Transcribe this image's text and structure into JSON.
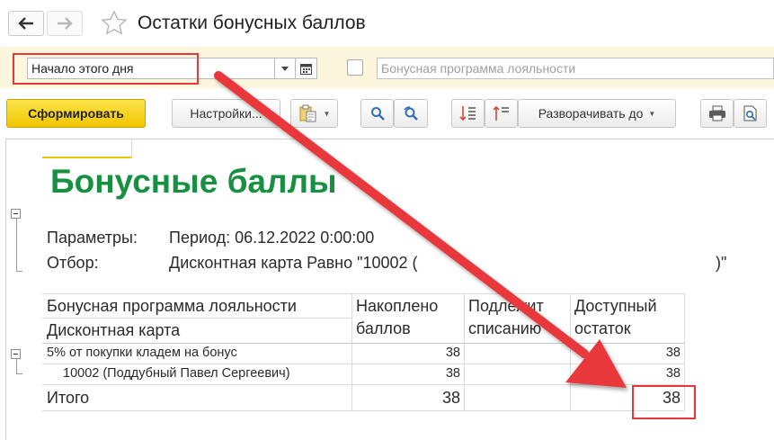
{
  "window": {
    "title": "Остатки бонусных баллов"
  },
  "filters": {
    "period_value": "Начало этого дня",
    "program_placeholder": "Бонусная программа лояльности"
  },
  "toolbar": {
    "generate_label": "Сформировать",
    "settings_label": "Настройки...",
    "expand_label": "Разворачивать до"
  },
  "report": {
    "heading": "Бонусные баллы",
    "params_label": "Параметры:",
    "params_value": "Период: 06.12.2022 0:00:00",
    "filter_label": "Отбор:",
    "filter_value_start": "Дисконтная карта Равно \"10002 (",
    "filter_value_end": ")\""
  },
  "table": {
    "group_header_1": "Бонусная программа лояльности",
    "group_header_2": "Дисконтная карта",
    "columns": [
      {
        "line1": "Накоплено",
        "line2": "баллов"
      },
      {
        "line1": "Подлежит",
        "line2": "списанию"
      },
      {
        "line1": "Доступный",
        "line2": "остаток"
      }
    ],
    "rows": [
      {
        "name": "5% от покупки кладем на бонус",
        "accrued": "38",
        "to_write_off": "",
        "available": "38"
      },
      {
        "name": "10002 (Поддубный Павел Сергеевич)",
        "accrued": "38",
        "to_write_off": "",
        "available": "38"
      }
    ],
    "total": {
      "label": "Итого",
      "accrued": "38",
      "to_write_off": "",
      "available": "38"
    }
  },
  "colors": {
    "heading_green": "#179141",
    "primary_yellow": "#f2c500",
    "filter_bar_bg": "#fbf6dc",
    "annotation_red": "#e8373b"
  }
}
